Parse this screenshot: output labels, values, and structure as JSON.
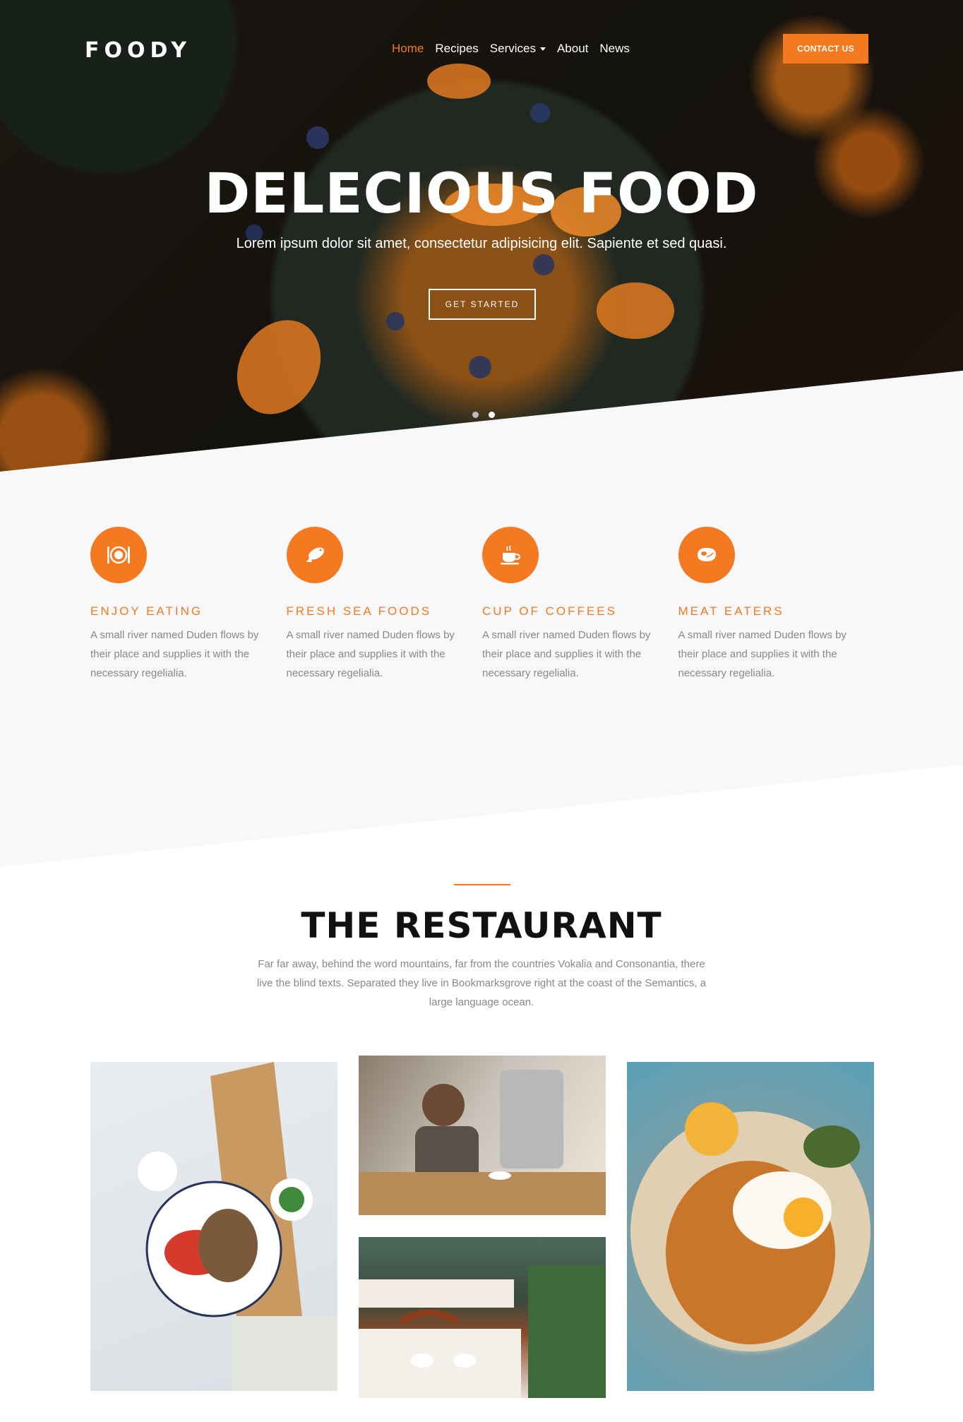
{
  "header": {
    "logo": "FOODY",
    "nav": [
      "Home",
      "Recipes",
      "Services",
      "About",
      "News"
    ],
    "contact_label": "CONTACT US"
  },
  "hero": {
    "title": "DELECIOUS FOOD",
    "subtitle": "Lorem ipsum dolor sit amet, consectetur adipisicing elit. Sapiente et sed quasi.",
    "cta": "GET STARTED",
    "slides": 2,
    "active_slide": 2
  },
  "features": [
    {
      "icon": "plate-cutlery-icon",
      "title": "ENJOY EATING",
      "text": "A small river named Duden flows by their place and supplies it with the necessary regelialia."
    },
    {
      "icon": "fish-icon",
      "title": "FRESH SEA FOODS",
      "text": "A small river named Duden flows by their place and supplies it with the necessary regelialia."
    },
    {
      "icon": "coffee-cup-icon",
      "title": "CUP OF COFFEES",
      "text": "A small river named Duden flows by their place and supplies it with the necessary regelialia."
    },
    {
      "icon": "steak-icon",
      "title": "MEAT EATERS",
      "text": "A small river named Duden flows by their place and supplies it with the necessary regelialia."
    }
  ],
  "restaurant": {
    "title": "THE RESTAURANT",
    "text": "Far far away, behind the word mountains, far from the countries Vokalia and Consonantia, there live the blind texts. Separated they live in Bookmarksgrove right at the coast of the Semantics, a large language ocean."
  },
  "colors": {
    "accent": "#f47920",
    "text_muted": "#888888",
    "features_bg": "#f7f8fa"
  }
}
